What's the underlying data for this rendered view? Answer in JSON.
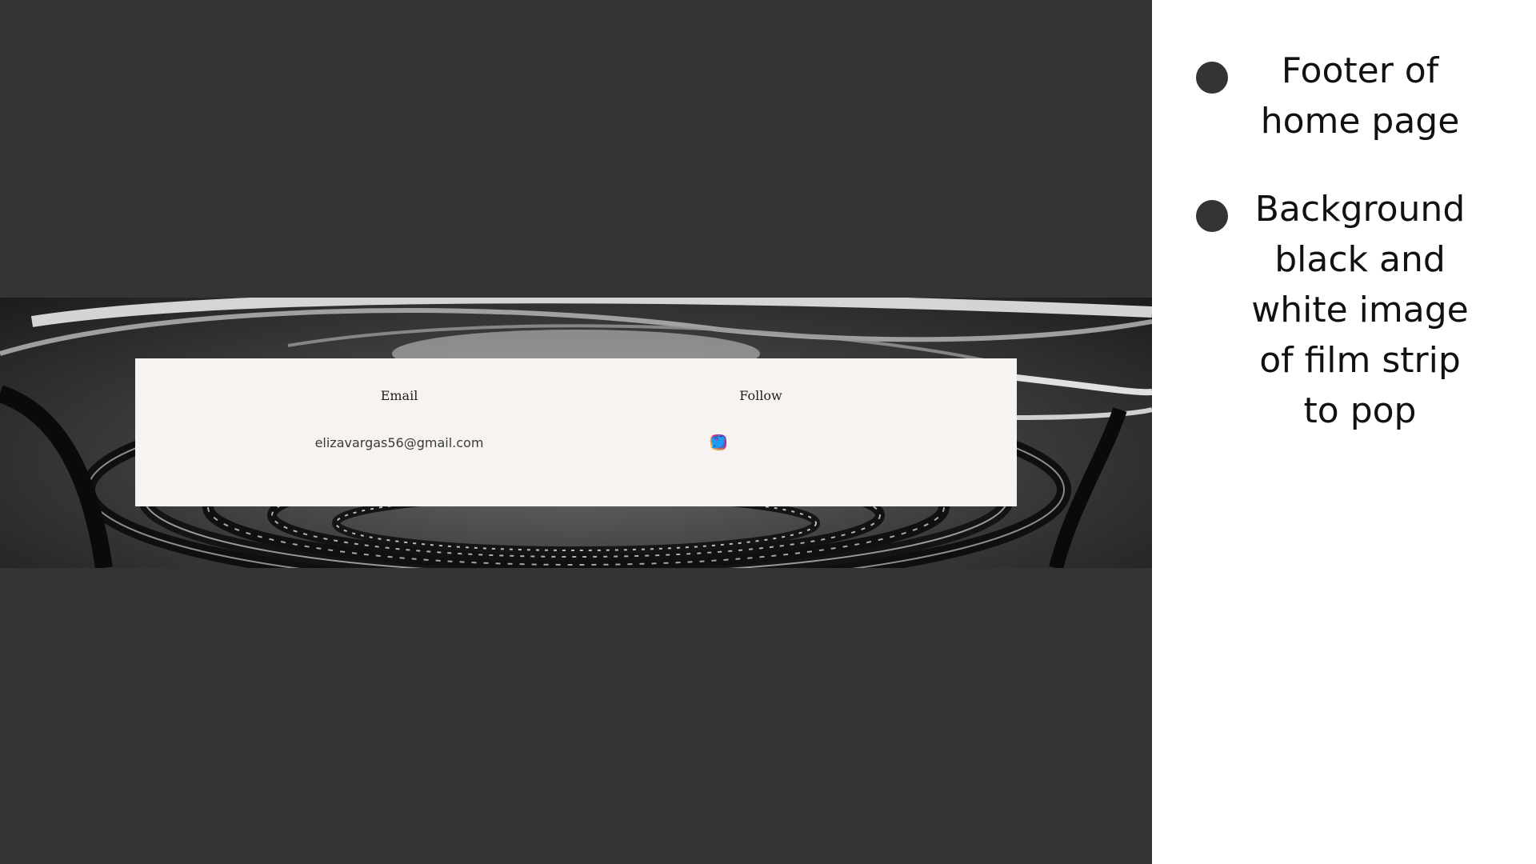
{
  "footer": {
    "email_heading": "Email",
    "email_value": "elizavargas56@gmail.com",
    "follow_heading": "Follow",
    "social_icons": [
      "facebook-icon",
      "instagram-icon",
      "tiktok-icon",
      "twitter-icon"
    ]
  },
  "notes": [
    {
      "text": "Footer of home page"
    },
    {
      "text": "Background black and white image of film strip to pop"
    }
  ],
  "colors": {
    "stage_background": "#343434",
    "card_background": "#f6f3f0",
    "facebook": "#1877f2",
    "twitter": "#1d9bf0",
    "bullet": "#343434"
  }
}
